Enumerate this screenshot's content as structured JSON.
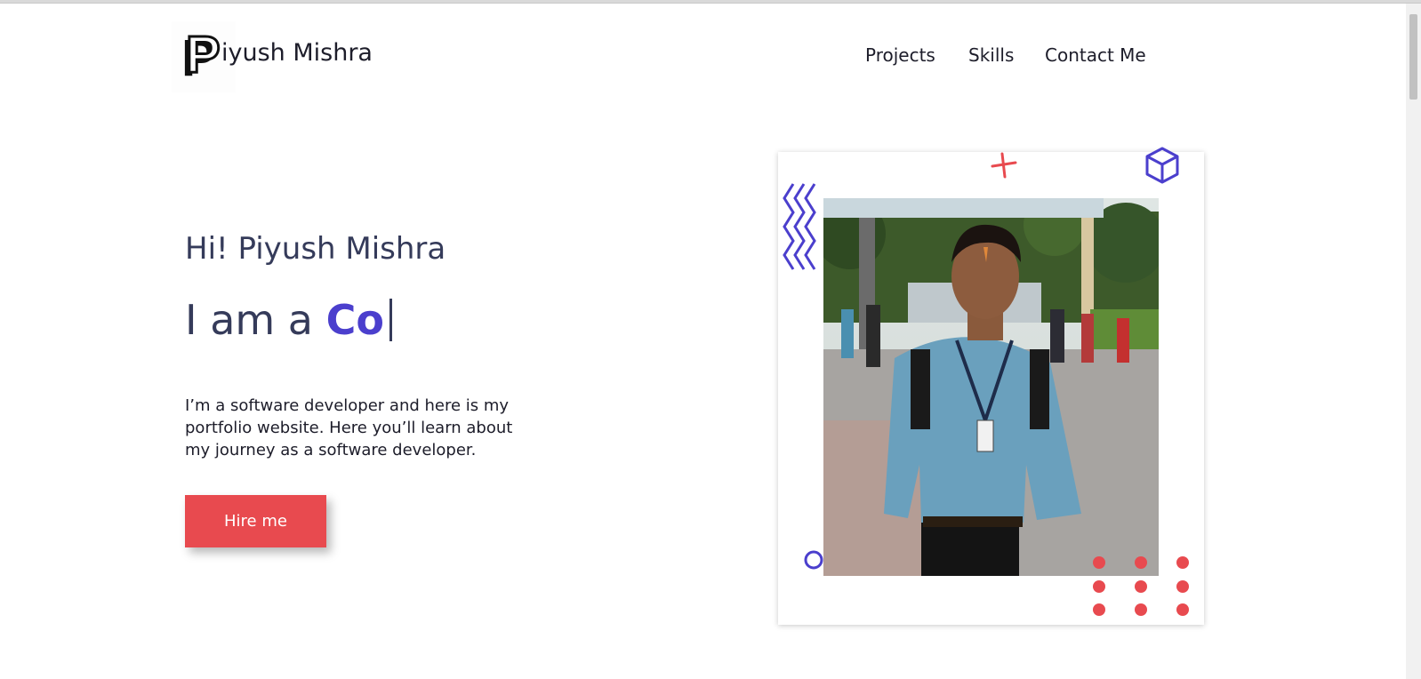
{
  "brand": {
    "logo_letter": "P",
    "name_rest": "iyush Mishra"
  },
  "nav": {
    "items": [
      "Projects",
      "Skills",
      "Contact Me"
    ]
  },
  "hero": {
    "greeting": "Hi! Piyush Mishra",
    "role_prefix": "I am a",
    "role_typed": "Co",
    "description": "I’m a software developer and here is my portfolio website. Here you’ll learn about my journey as a software developer.",
    "cta_label": "Hire me"
  },
  "colors": {
    "accent": "#4b3fcd",
    "cta": "#e84a4f",
    "text": "#353b5a"
  },
  "icons": [
    "zigzag-lines-icon",
    "plus-icon",
    "cube-icon",
    "circle-outline-icon",
    "dot-grid-icon"
  ]
}
